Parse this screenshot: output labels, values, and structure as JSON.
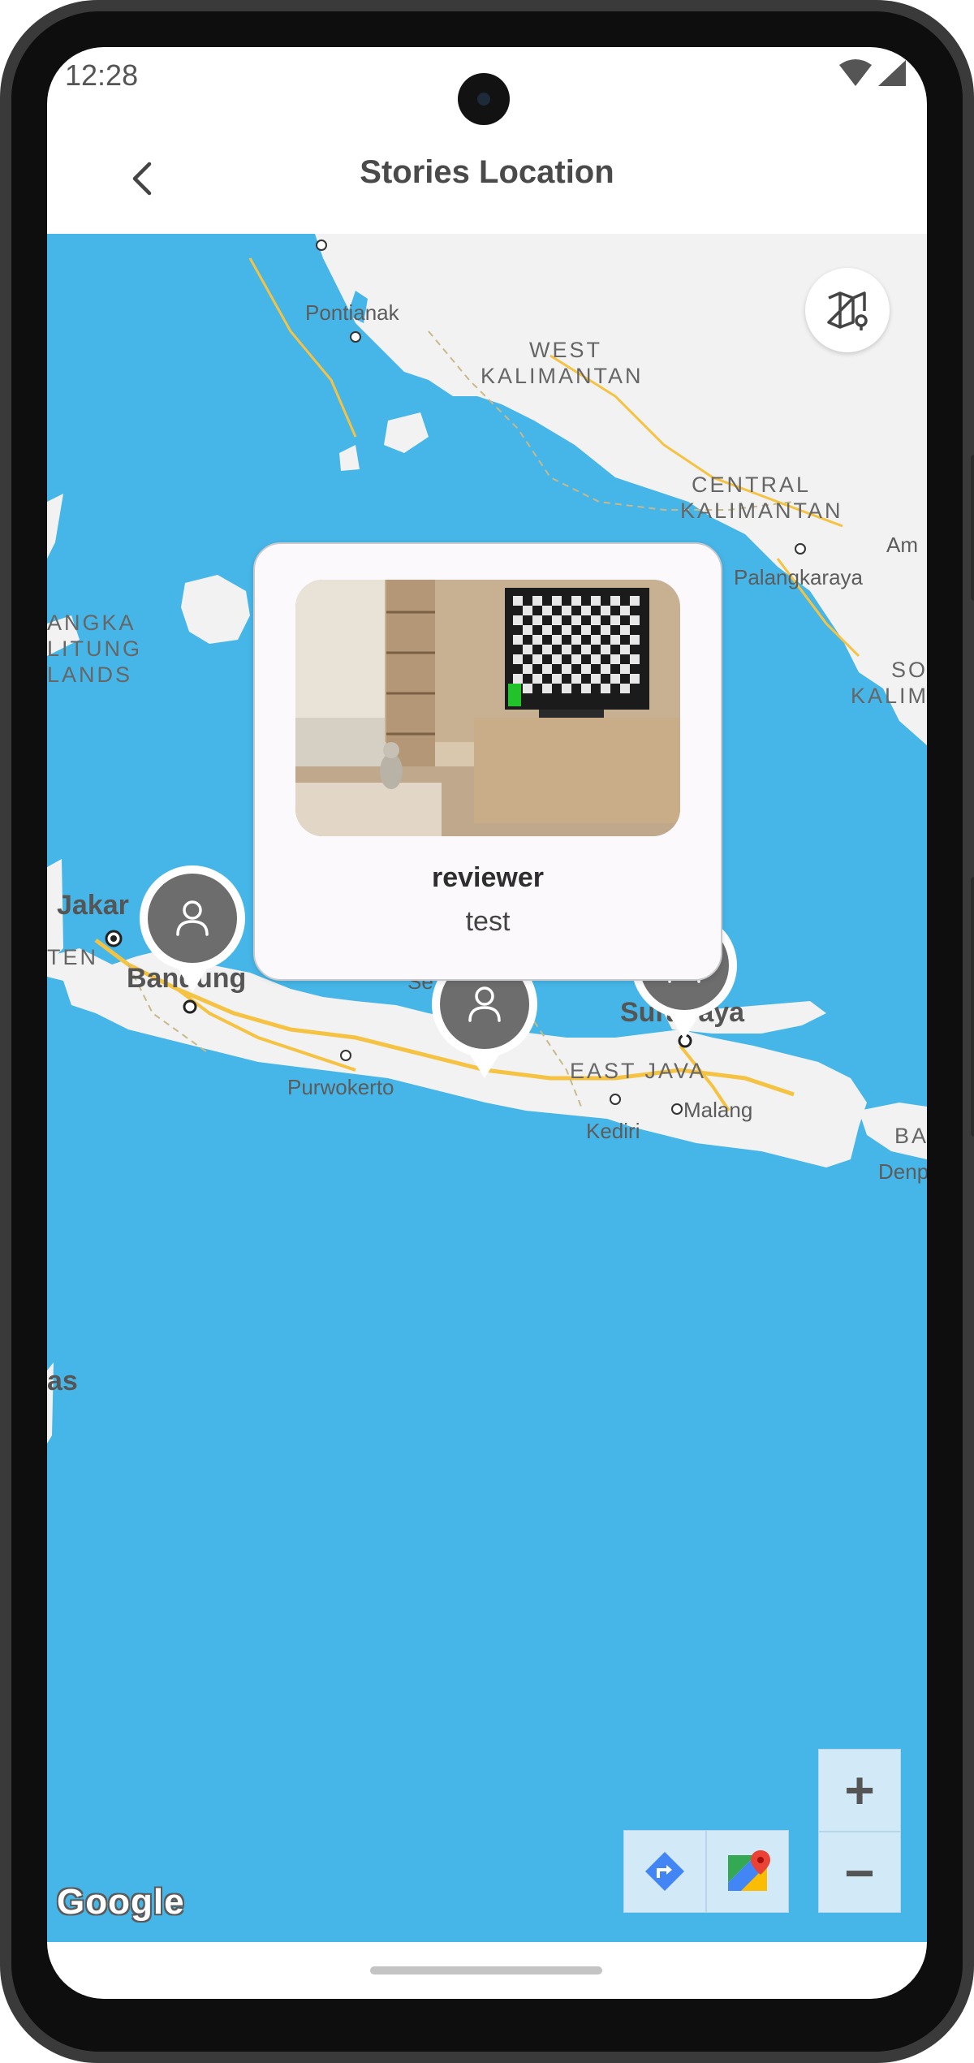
{
  "status_bar": {
    "time": "12:28",
    "icons": [
      "wifi-icon",
      "signal-icon"
    ]
  },
  "app_bar": {
    "title": "Stories Location",
    "back_icon": "back-arrow-icon"
  },
  "map": {
    "labels": {
      "pontianak": "Pontianak",
      "west_kalimantan_1": "WEST",
      "west_kalimantan_2": "KALIMANTAN",
      "central_kalimantan_1": "CENTRAL",
      "central_kalimantan_2": "KALIMANTAN",
      "palangkaraya": "Palangkaraya",
      "am": "Am",
      "south_kal_1": "SO",
      "south_kal_2": "KALIM",
      "bangka_1": "ANGKA",
      "bangka_2": "LITUNG",
      "bangka_3": "LANDS",
      "jakarta": "Jakar",
      "banten": "TEN",
      "bandung": "Bandung",
      "semarang": "Se",
      "surabaya": "Surabaya",
      "east_java": "EAST JAVA",
      "purwokerto": "Purwokerto",
      "kediri": "Kediri",
      "malang": "Malang",
      "bali": "BA",
      "denpasar": "Denp",
      "as": "as"
    },
    "google_logo": "Google"
  },
  "info_window": {
    "name": "reviewer",
    "description": "test"
  },
  "controls": {
    "zoom_in": "+",
    "zoom_out": "−"
  },
  "colors": {
    "water": "#46b6e8",
    "land": "#f2f2f2",
    "marker": "#6d6d6d",
    "road": "#f5c242"
  }
}
